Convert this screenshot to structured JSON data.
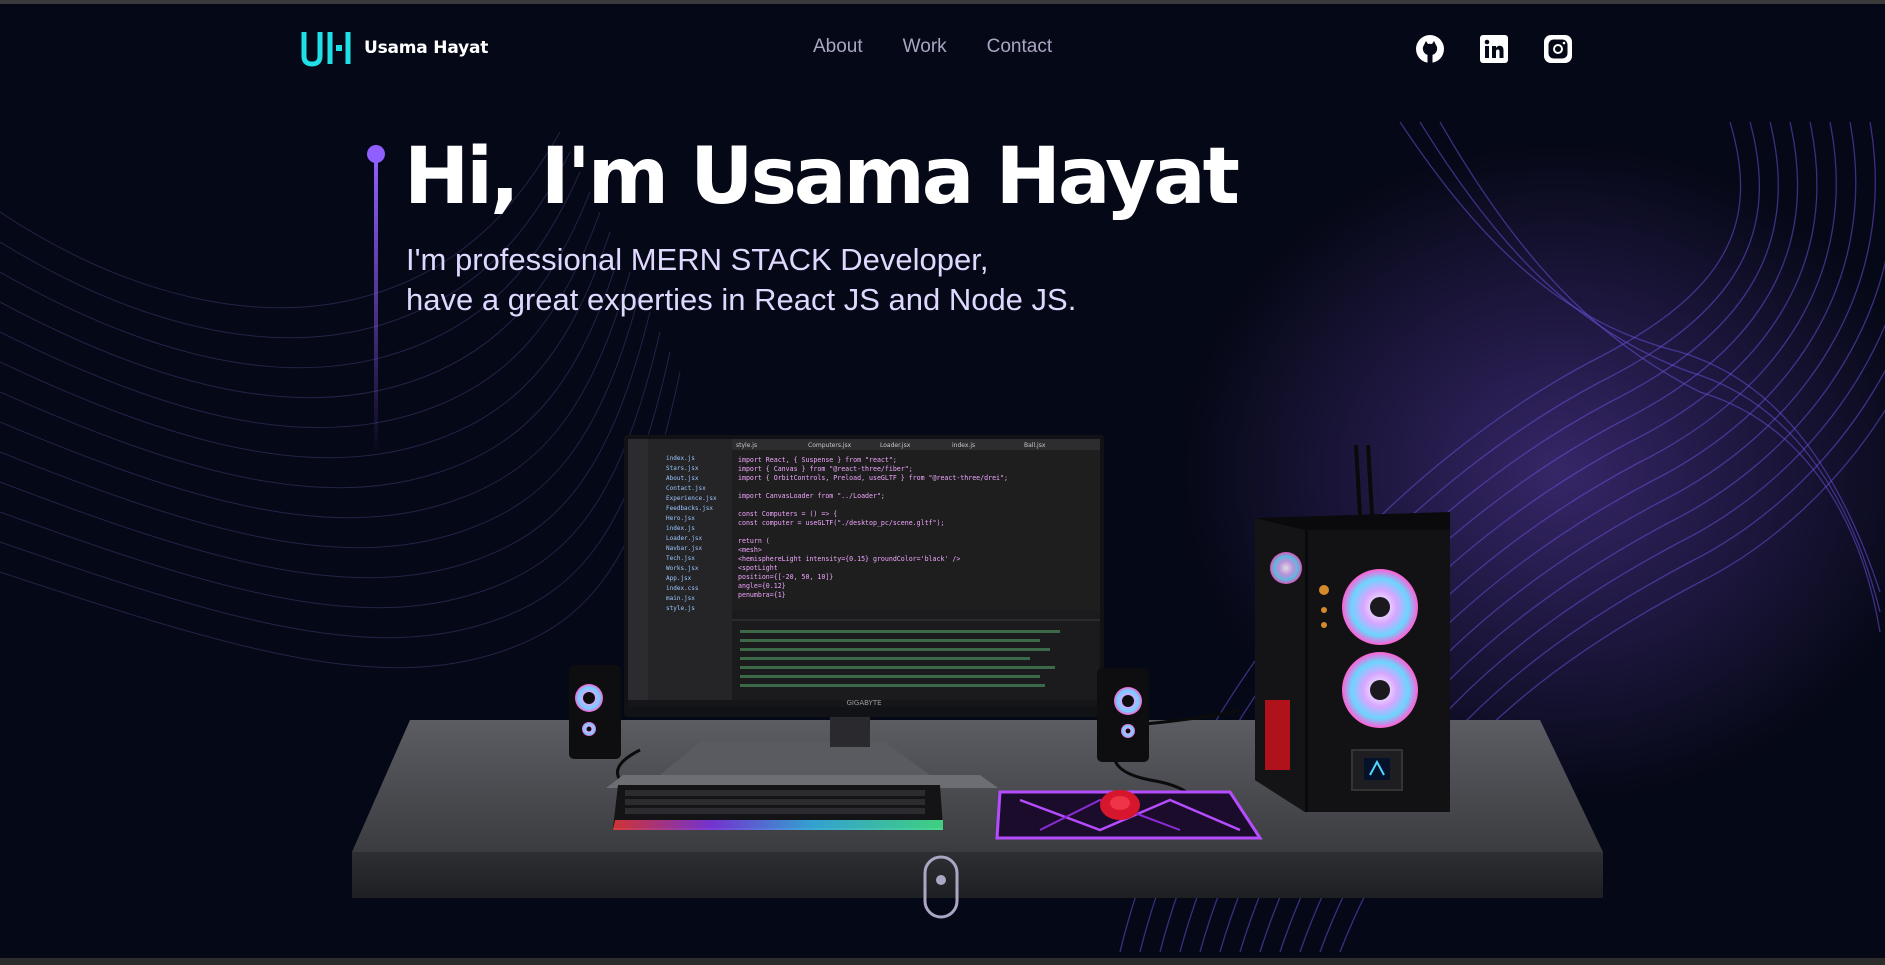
{
  "nav": {
    "logo_mark": "UH",
    "brand_name": "Usama Hayat",
    "links": [
      {
        "label": "About"
      },
      {
        "label": "Work"
      },
      {
        "label": "Contact"
      }
    ],
    "socials": [
      {
        "icon": "github-icon"
      },
      {
        "icon": "linkedin-icon"
      },
      {
        "icon": "instagram-icon"
      }
    ]
  },
  "hero": {
    "title": "Hi, I'm Usama Hayat",
    "subtitle_line1": "I'm professional MERN STACK Developer,",
    "subtitle_line2": "have a great experties in React JS and Node JS."
  },
  "scene": {
    "monitor_brand": "GIGABYTE",
    "code_lines": [
      "import React, { Suspense } from \"react\";",
      "import { Canvas } from \"@react-three/fiber\";",
      "import { OrbitControls, Preload, useGLTF } from \"@react-three/drei\";",
      "",
      "import CanvasLoader from \"../Loader\";",
      "",
      "const Computers = () => {",
      "  const computer = useGLTF(\"./desktop_pc/scene.gltf\");",
      "",
      "  return (",
      "    <mesh>",
      "      <hemisphereLight intensity={0.15} groundColor='black' />",
      "      <spotLight",
      "        position={[-20, 50, 10]}",
      "        angle={0.12}",
      "        penumbra={1}"
    ],
    "editor_tabs": [
      "style.js",
      "Computers.jsx",
      "Loader.jsx",
      "index.js",
      "Ball.jsx"
    ],
    "explorer_files": [
      "index.js",
      "Stars.jsx",
      "About.jsx",
      "Contact.jsx",
      "Experience.jsx",
      "Feedbacks.jsx",
      "Hero.jsx",
      "index.js",
      "Loader.jsx",
      "Navbar.jsx",
      "Tech.jsx",
      "Works.jsx",
      "App.jsx",
      "index.css",
      "main.jsx",
      "style.js"
    ]
  },
  "colors": {
    "background": "#050816",
    "accent_purple": "#915eff",
    "logo_cyan": "#1fe0e6",
    "nav_text": "#aaa6c3"
  }
}
